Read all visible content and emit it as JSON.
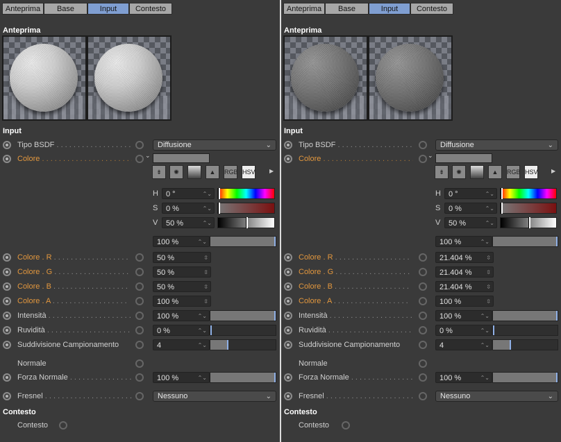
{
  "tabs": [
    "Anteprima",
    "Base",
    "Input",
    "Contesto"
  ],
  "active_tab": "Input",
  "sections": {
    "preview": "Anteprima",
    "input": "Input",
    "context": "Contesto"
  },
  "labels": {
    "bsdf": "Tipo BSDF",
    "color": "Colore",
    "color_r": "Colore . R",
    "color_g": "Colore . G",
    "color_b": "Colore . B",
    "color_a": "Colore . A",
    "intensity": "Intensità",
    "roughness": "Ruvidità",
    "subdivision": "Suddivisione Campionamento",
    "normal": "Normale",
    "normal_strength": "Forza Normale",
    "fresnel": "Fresnel",
    "context": "Contesto"
  },
  "picker": {
    "h_label": "H",
    "s_label": "S",
    "v_label": "V",
    "rgb_label": "RGB",
    "hsv_label": "HSV",
    "h": "0 °",
    "s": "0 %",
    "v": "50 %",
    "mix": "100 %"
  },
  "panels": [
    {
      "id": "left",
      "bsdf": "Diffusione",
      "r": "50 %",
      "g": "50 %",
      "b": "50 %",
      "a": "100 %",
      "intensity": "100 %",
      "roughness": "0 %",
      "subdivision": "4",
      "normal_strength": "100 %",
      "fresnel": "Nessuno"
    },
    {
      "id": "right",
      "bsdf": "Diffusione",
      "r": "21.404 %",
      "g": "21.404 %",
      "b": "21.404 %",
      "a": "100 %",
      "intensity": "100 %",
      "roughness": "0 %",
      "subdivision": "4",
      "normal_strength": "100 %",
      "fresnel": "Nessuno"
    }
  ],
  "colors": {
    "accent_tab": "#7f9ed1",
    "orange_label": "#e2973e",
    "swatch_gray": "#808080"
  }
}
